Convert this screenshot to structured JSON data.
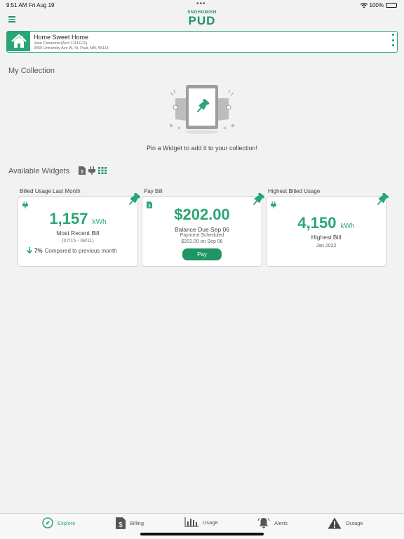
{
  "status_bar": {
    "time": "9:51 AM",
    "date": "Fri Aug 19",
    "battery": "100%"
  },
  "logo": {
    "top": "SNOHOMISH",
    "main": "PUD"
  },
  "account": {
    "name": "Home Sweet Home",
    "account_line": "Jane Consumer(Acct 11111111)",
    "address": "2550 University Ave W, St. Paul, MN, 55114"
  },
  "collection": {
    "title": "My Collection",
    "empty_text": "Pin a Widget to add it to your collection!"
  },
  "available": {
    "title": "Available Widgets"
  },
  "widgets": {
    "usage": {
      "label": "Billed Usage Last Month",
      "value": "1,157",
      "unit": "kWh",
      "subtitle": "Most Recent Bill",
      "period": "(07/15 - 08/11)",
      "compare_pct": "7%",
      "compare_text": "Compared to previous month"
    },
    "pay": {
      "label": "Pay Bill",
      "amount": "$202.00",
      "due": "Balance Due Sep 06",
      "status": "Payment Scheduled",
      "scheduled": "$202.00 on Sep 06",
      "button": "Pay"
    },
    "highest": {
      "label": "Highest Billed Usage",
      "value": "4,150",
      "unit": "kWh",
      "subtitle": "Highest Bill",
      "date": "Jan 2022"
    }
  },
  "tabs": [
    {
      "label": "Explore",
      "icon": "compass-icon",
      "active": true
    },
    {
      "label": "Billing",
      "icon": "bill-icon",
      "active": false
    },
    {
      "label": "Usage",
      "icon": "bar-chart-icon",
      "active": false
    },
    {
      "label": "Alerts",
      "icon": "bell-icon",
      "active": false
    },
    {
      "label": "Outage",
      "icon": "warning-icon",
      "active": false
    }
  ],
  "colors": {
    "accent": "#2aa676",
    "accent_dark": "#1f9464",
    "background": "#f2f2f2"
  }
}
